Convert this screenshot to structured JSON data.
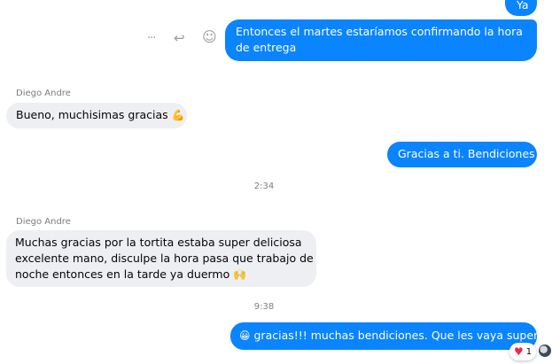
{
  "messages": {
    "m0": "Ya",
    "m1_line1": "Entonces el martes estaríamos confirmando la hora",
    "m1_line2": "de entrega",
    "sender1": "Diego Andre",
    "m2_text": "Bueno, muchisimas gracias",
    "m2_emoji": "💪",
    "m3": "Gracias a ti. Bendiciones",
    "time1": "2:34",
    "sender2": "Diego Andre",
    "m4_line1": "Muchas gracias por la tortita estaba super deliciosa",
    "m4_line2": "excelente mano, disculpe la hora pasa que trabajo de",
    "m4_line3": "noche entonces en la tarde ya duermo",
    "m4_emoji": "🙌",
    "time2": "9:38",
    "m5_emoji": "😀",
    "m5_text": "gracias!!! muchas bendiciones. Que les vaya super"
  },
  "actions": {
    "more_icon": "···",
    "reply_icon": "↩",
    "react_icon": "☺"
  },
  "reaction": {
    "heart": "♥",
    "count": "1"
  },
  "colors": {
    "outgoing": "#0a84ff",
    "incoming": "#eeeff2",
    "meta_text": "#7a7d82"
  }
}
